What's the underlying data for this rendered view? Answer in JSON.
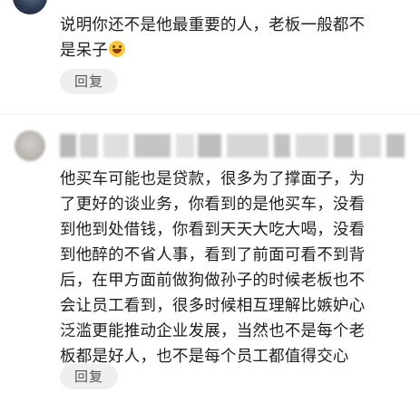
{
  "comments": [
    {
      "text": "说明你还不是他最重要的人，老板一般都不\n是呆子",
      "emoji": "grinning-sweat",
      "reply_label": "回复"
    },
    {
      "text": "他买车可能也是贷款，很多为了撑面子，为\n了更好的谈业务，你看到的是他买车，没看\n到他到处借钱，你看到天天大吃大喝，没看\n到他醉的不省人事，看到了前面可看不到背\n后，在甲方面前做狗做孙子的时候老板也不\n会让员工看到，很多时候相互理解比嫉妒心\n泛滥更能推动企业发展，当然也不是每个老\n板都是好人，也不是每个员工都值得交心",
      "reply_label": "回复"
    }
  ]
}
